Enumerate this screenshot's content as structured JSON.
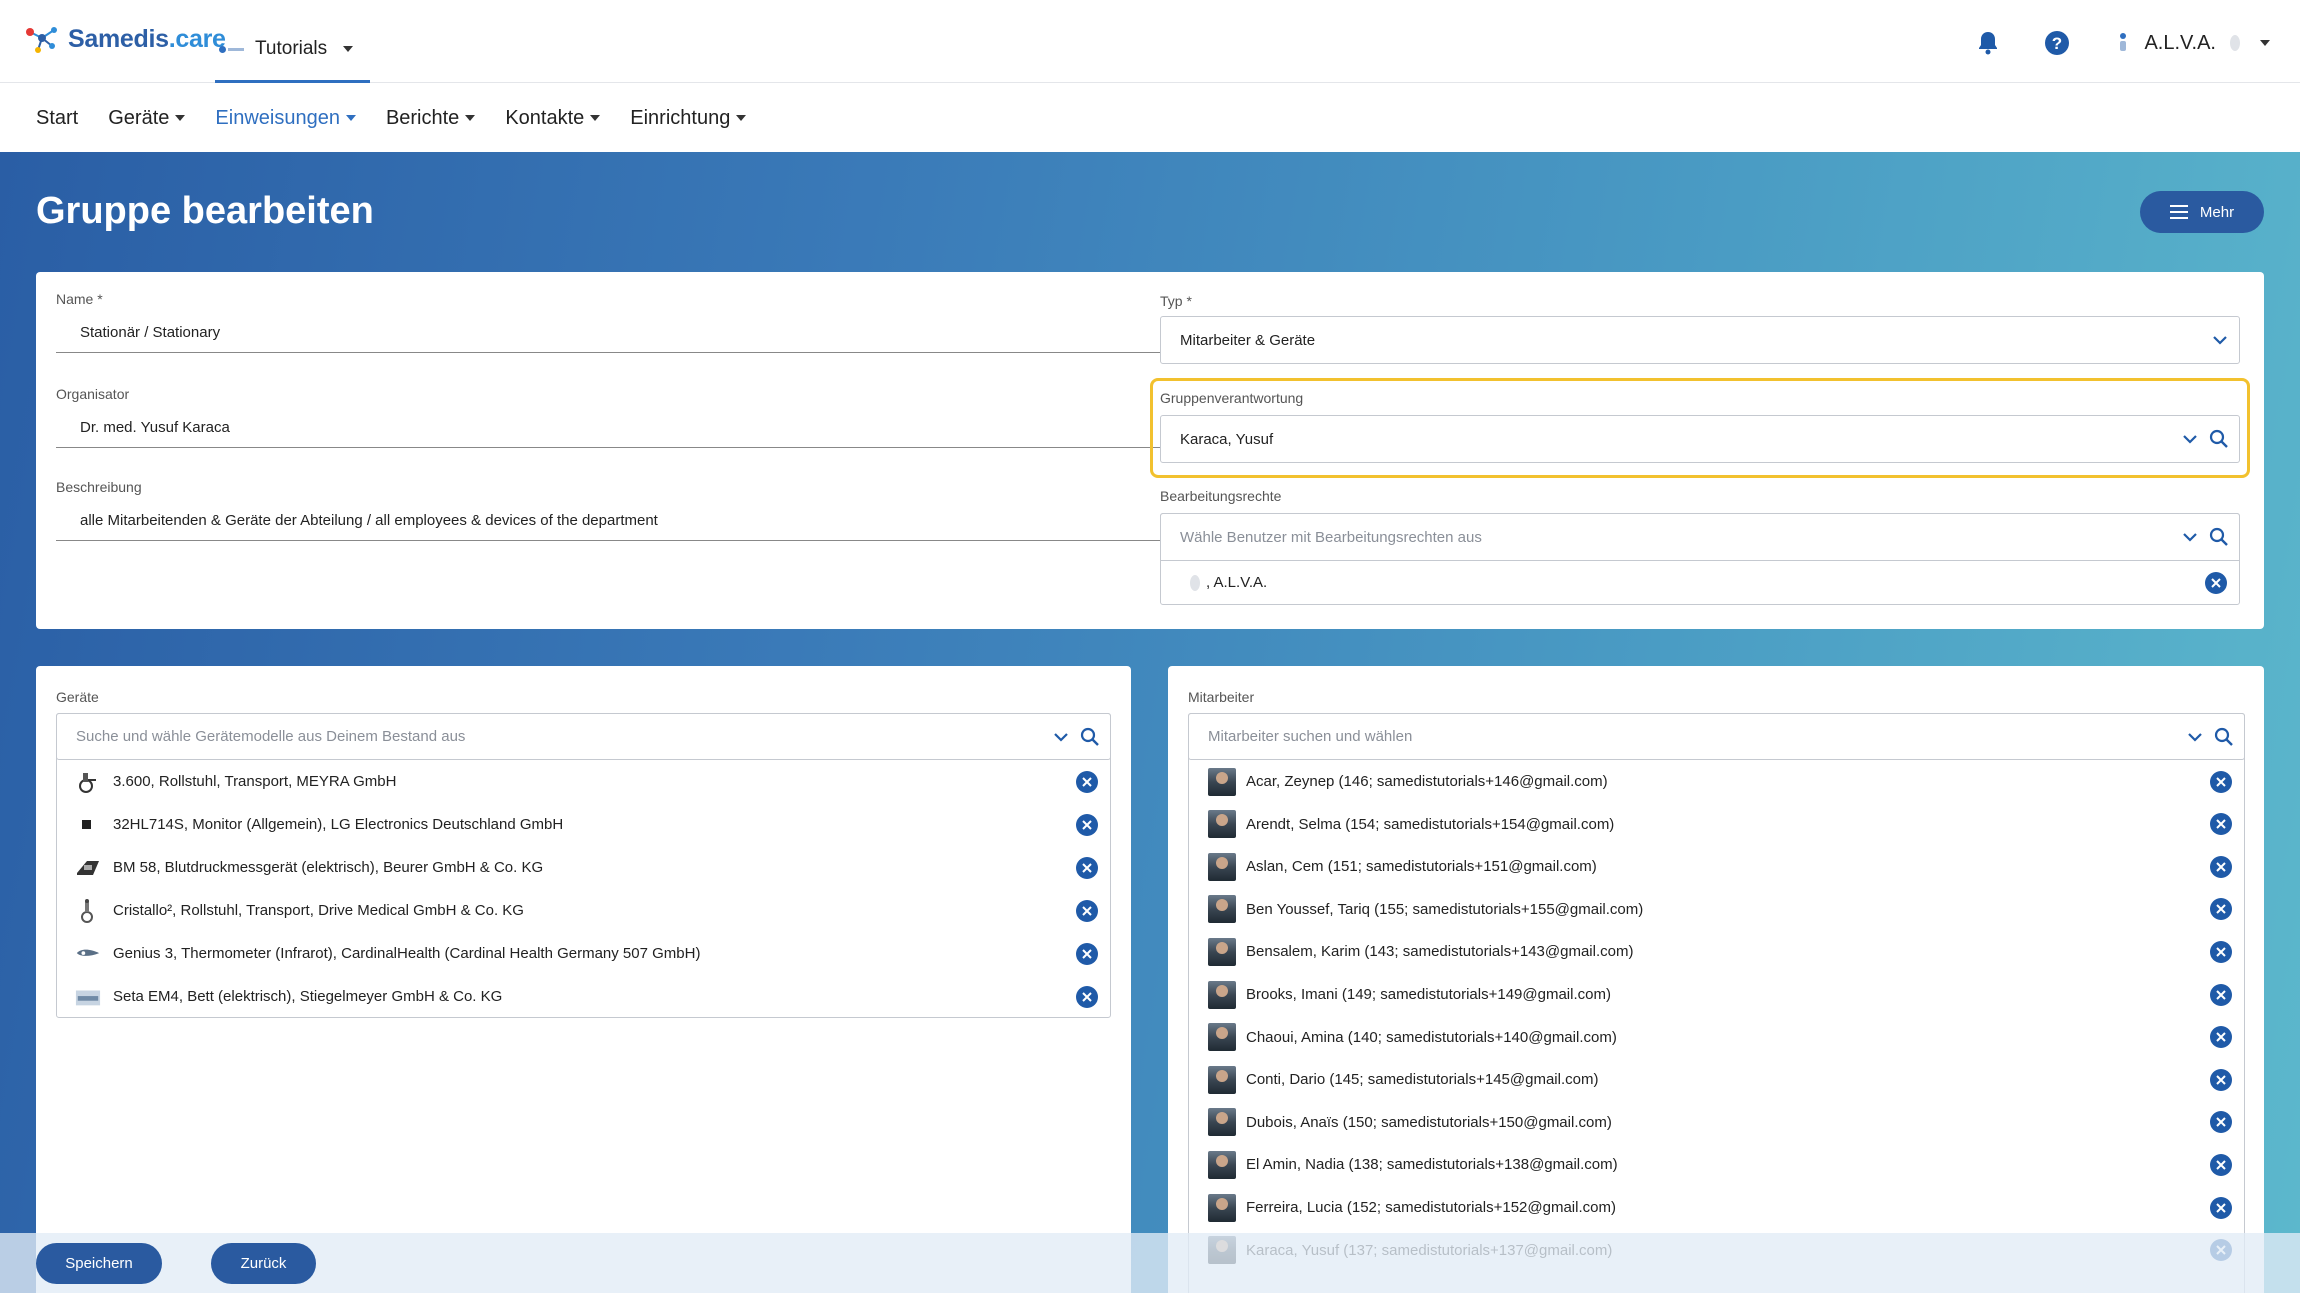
{
  "brand": {
    "logo_text_a": "Samedis",
    "logo_text_b": ".care"
  },
  "tenant": {
    "label": "Tutorials"
  },
  "user": {
    "name": "A.L.V.A."
  },
  "icons": {
    "bell": "bell-icon",
    "help": "help-icon",
    "menu": "menu-icon",
    "search": "search-icon",
    "chevron": "chevron-down-icon",
    "remove": "close-circle-icon"
  },
  "colors": {
    "accent": "#2f6fc0",
    "primary_button": "#2a5aa0",
    "highlight": "#f2c12e"
  },
  "nav": [
    {
      "label": "Start",
      "dropdown": false
    },
    {
      "label": "Geräte",
      "dropdown": true
    },
    {
      "label": "Einweisungen",
      "dropdown": true,
      "active": true
    },
    {
      "label": "Berichte",
      "dropdown": true
    },
    {
      "label": "Kontakte",
      "dropdown": true
    },
    {
      "label": "Einrichtung",
      "dropdown": true
    }
  ],
  "page": {
    "title": "Gruppe bearbeiten",
    "more_label": "Mehr"
  },
  "form": {
    "name_label": "Name *",
    "name_value": "Stationär / Stationary",
    "organizer_label": "Organisator",
    "organizer_value": "Dr. med. Yusuf Karaca",
    "description_label": "Beschreibung",
    "description_value": "alle Mitarbeitenden & Geräte der Abteilung / all employees & devices of the department",
    "type_label": "Typ *",
    "type_value": "Mitarbeiter & Geräte",
    "responsibility_label": "Gruppenverantwortung",
    "responsibility_value": "Karaca, Yusuf",
    "rights_label": "Bearbeitungsrechte",
    "rights_placeholder": "Wähle Benutzer mit Bearbeitungsrechten aus",
    "rights_selected": ", A.L.V.A."
  },
  "devices": {
    "label": "Geräte",
    "placeholder": "Suche und wähle Gerätemodelle aus Deinem Bestand aus",
    "items": [
      "3.600, Rollstuhl, Transport, MEYRA GmbH",
      "32HL714S, Monitor (Allgemein), LG Electronics Deutschland GmbH",
      "BM 58, Blutdruckmessgerät (elektrisch), Beurer GmbH & Co. KG",
      "Cristallo², Rollstuhl, Transport, Drive Medical GmbH & Co. KG",
      "Genius 3, Thermometer (Infrarot), CardinalHealth (Cardinal Health Germany 507 GmbH)",
      "Seta EM4, Bett (elektrisch), Stiegelmeyer GmbH & Co. KG"
    ]
  },
  "employees": {
    "label": "Mitarbeiter",
    "placeholder": "Mitarbeiter suchen und wählen",
    "items": [
      "Acar, Zeynep (146; samedistutorials+146@gmail.com)",
      "Arendt, Selma (154; samedistutorials+154@gmail.com)",
      "Aslan, Cem (151; samedistutorials+151@gmail.com)",
      "Ben Youssef, Tariq (155; samedistutorials+155@gmail.com)",
      "Bensalem, Karim (143; samedistutorials+143@gmail.com)",
      "Brooks, Imani (149; samedistutorials+149@gmail.com)",
      "Chaoui, Amina (140; samedistutorials+140@gmail.com)",
      "Conti, Dario (145; samedistutorials+145@gmail.com)",
      "Dubois, Anaïs (150; samedistutorials+150@gmail.com)",
      "El Amin, Nadia (138; samedistutorials+138@gmail.com)",
      "Ferreira, Lucia (152; samedistutorials+152@gmail.com)",
      "Karaca, Yusuf (137; samedistutorials+137@gmail.com)"
    ]
  },
  "actions": {
    "save_label": "Speichern",
    "back_label": "Zurück"
  }
}
